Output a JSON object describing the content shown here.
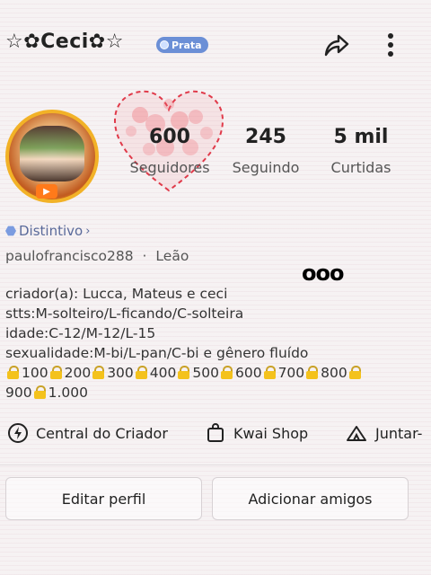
{
  "profile": {
    "name": "☆✿Ceci✿☆",
    "badge_label": "Prata",
    "distintivo_label": "Distintivo",
    "username": "paulofrancisco288",
    "separator": "·",
    "sign": "Leão",
    "more_indicator": "ooo"
  },
  "stats": [
    {
      "value": "600",
      "label": "Seguidores"
    },
    {
      "value": "245",
      "label": "Seguindo"
    },
    {
      "value": "5 mil",
      "label": "Curtidas"
    }
  ],
  "bio": {
    "line1": "criador(a): Lucca, Mateus e ceci",
    "line2": "stts:M-solteiro/L-ficando/C-solteira",
    "line3": "idade:C-12/M-12/L-15",
    "line4": "sexualidade:M-bi/L-pan/C-bi e gênero fluído",
    "locks": [
      "100",
      "200",
      "300",
      "400",
      "500",
      "600",
      "700",
      "800",
      "900",
      "1.000"
    ]
  },
  "links": {
    "creator_center": "Central do Criador",
    "kwai_shop": "Kwai Shop",
    "join": "Juntar-"
  },
  "buttons": {
    "edit_profile": "Editar perfil",
    "add_friends": "Adicionar amigos"
  },
  "icons": {
    "share": "share-icon",
    "more": "more-vert-icon",
    "creator": "creator-bolt-icon",
    "shop": "shopping-bag-icon",
    "join": "tent-icon"
  },
  "colors": {
    "heart": "#e03a4a",
    "badge": "#6b8fd6",
    "lock": "#f4c21c"
  }
}
